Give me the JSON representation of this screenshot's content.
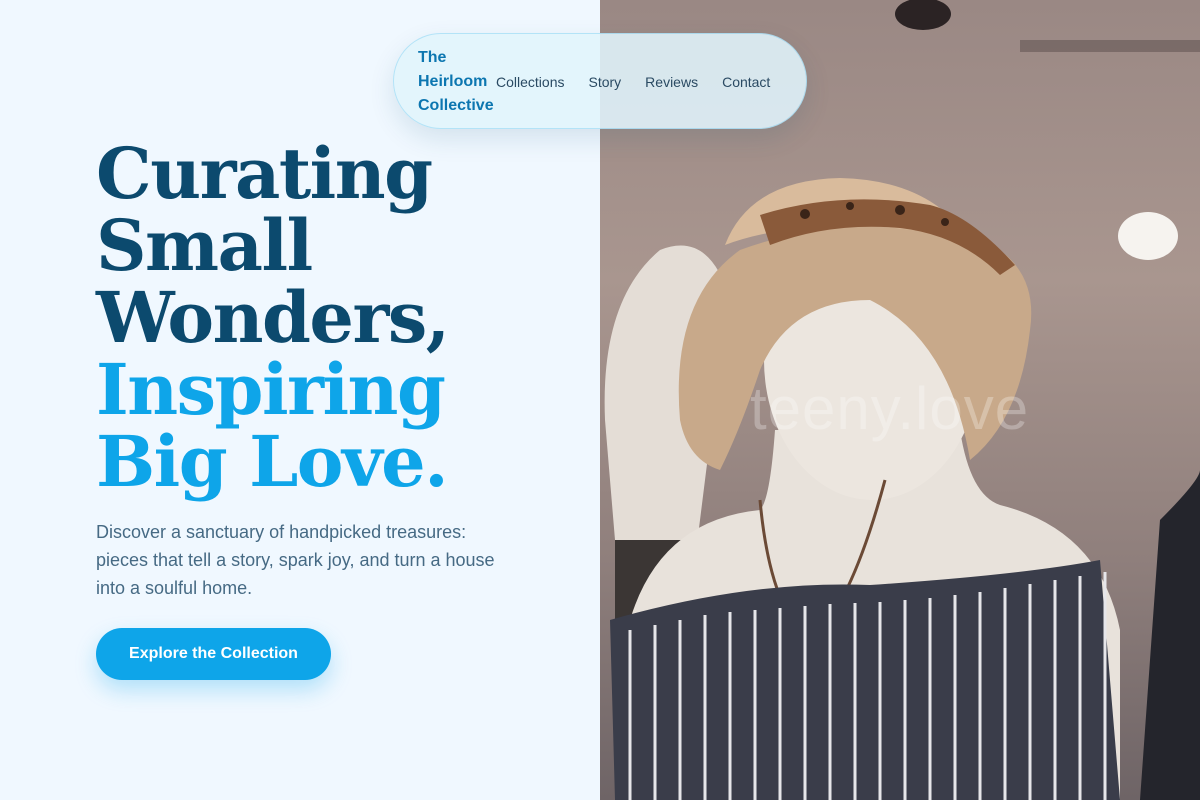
{
  "nav": {
    "brand": "The Heirloom Collective",
    "links": [
      "Collections",
      "Story",
      "Reviews",
      "Contact"
    ]
  },
  "hero": {
    "headline_lines": [
      "Curating",
      "Small",
      "Wonders,"
    ],
    "headline_accent_lines": [
      "Inspiring",
      "Big Love."
    ],
    "description": "Discover a sanctuary of handpicked treasures: pieces that tell a story, spark joy, and turn a house into a soulful home.",
    "cta_label": "Explore the Collection"
  },
  "image": {
    "watermark": "teeny.love",
    "subject": "mannequin-photo"
  },
  "colors": {
    "background": "#f0f8ff",
    "headline_dark": "#0c4a6e",
    "accent": "#0ea5e9",
    "body_text": "#466a84",
    "brand": "#0c76b0"
  }
}
